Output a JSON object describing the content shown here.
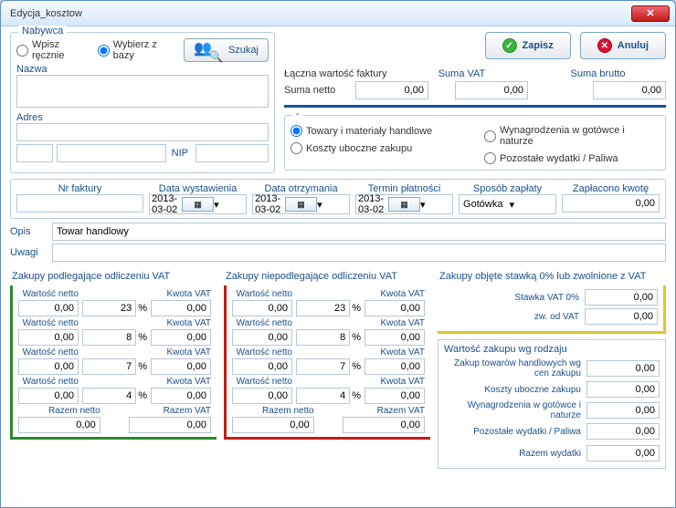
{
  "window": {
    "title": "Edycja_kosztow"
  },
  "buyer": {
    "group": "Nabywca",
    "radio_manual": "Wpisz ręcznie",
    "radio_db": "Wybierz z bazy",
    "search_btn": "Szukaj",
    "name_label": "Nazwa",
    "addr_label": "Adres",
    "nip_label": "NIP"
  },
  "actions": {
    "save": "Zapisz",
    "cancel": "Anuluj"
  },
  "totals": {
    "title": "Łączna wartość faktury",
    "net_label": "Suma netto",
    "net": "0,00",
    "vat_label": "Suma VAT",
    "vat": "0,00",
    "gross_label": "Suma brutto",
    "gross": "0,00"
  },
  "category": {
    "dash": "-",
    "r1": "Towary i materiały handlowe",
    "r2": "Koszty uboczne zakupu",
    "r3": "Wynagrodzenia w gotówce i naturze",
    "r4": "Pozostałe wydatki / Paliwa"
  },
  "invoice": {
    "nr_label": "Nr faktury",
    "d1_label": "Data wystawienia",
    "d1": "2013-03-02",
    "d2_label": "Data otrzymania",
    "d2": "2013-03-02",
    "d3_label": "Termin płatności",
    "d3": "2013-03-02",
    "pay_label": "Sposób zapłaty",
    "pay": "Gotówka",
    "paid_label": "Zapłacono kwotę",
    "paid": "0,00"
  },
  "desc": {
    "opis_label": "Opis",
    "opis": "Towar handlowy",
    "uwagi_label": "Uwagi"
  },
  "vat_ded": {
    "title": "Zakupy podlegające odliczeniu VAT",
    "net_label": "Wartość netto",
    "vat_label": "Kwota VAT",
    "sum_net_label": "Razem netto",
    "sum_vat_label": "Razem VAT",
    "rows": [
      {
        "net": "0,00",
        "rate": "23",
        "vat": "0,00"
      },
      {
        "net": "0,00",
        "rate": "8",
        "vat": "0,00"
      },
      {
        "net": "0,00",
        "rate": "7",
        "vat": "0,00"
      },
      {
        "net": "0,00",
        "rate": "4",
        "vat": "0,00"
      }
    ],
    "sum_net": "0,00",
    "sum_vat": "0,00",
    "pct": "%"
  },
  "vat_noded": {
    "title": "Zakupy niepodlegające odliczeniu VAT",
    "rows": [
      {
        "net": "0,00",
        "rate": "23",
        "vat": "0,00"
      },
      {
        "net": "0,00",
        "rate": "8",
        "vat": "0,00"
      },
      {
        "net": "0,00",
        "rate": "7",
        "vat": "0,00"
      },
      {
        "net": "0,00",
        "rate": "4",
        "vat": "0,00"
      }
    ],
    "sum_net": "0,00",
    "sum_vat": "0,00"
  },
  "vat_zero": {
    "title": "Zakupy objęte stawką 0% lub zwolnione z VAT",
    "r1_label": "Stawka VAT 0%",
    "r1": "0,00",
    "r2_label": "zw. od VAT",
    "r2": "0,00"
  },
  "bytype": {
    "title": "Wartość zakupu wg rodzaju",
    "r1_label": "Zakup towarów handlowych wg cen zakupu",
    "r1": "0,00",
    "r2_label": "Koszty uboczne zakupu",
    "r2": "0,00",
    "r3_label": "Wynagrodzenia w gotówce i naturze",
    "r3": "0,00",
    "r4_label": "Pozostałe wydatki / Paliwa",
    "r4": "0,00",
    "sum_label": "Razem wydatki",
    "sum": "0,00"
  }
}
